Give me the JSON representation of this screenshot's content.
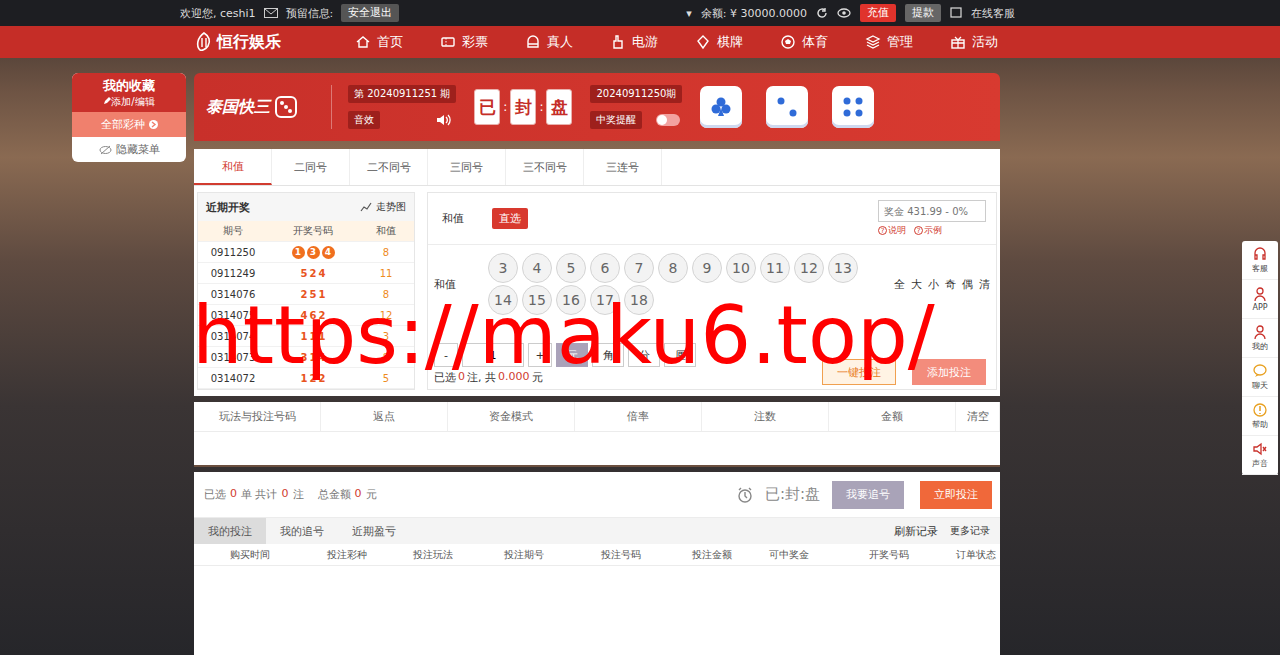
{
  "topbar": {
    "welcome": "欢迎您, ceshi1",
    "reserved": "预留信息:",
    "logout": "安全退出",
    "caret": "▾",
    "balance": "余额: ¥ 30000.0000",
    "recharge": "充值",
    "withdraw": "提款",
    "service": "在线客服"
  },
  "nav": {
    "logo": "恒行娱乐",
    "items": [
      {
        "label": "首页"
      },
      {
        "label": "彩票"
      },
      {
        "label": "真人"
      },
      {
        "label": "电游"
      },
      {
        "label": "棋牌"
      },
      {
        "label": "体育"
      },
      {
        "label": "管理"
      },
      {
        "label": "活动"
      }
    ]
  },
  "sidebar": {
    "title": "我的收藏",
    "edit": "添加/编辑",
    "items": [
      {
        "label": "全部彩种",
        "selected": true
      },
      {
        "label": "隐藏菜单",
        "selected": false
      }
    ]
  },
  "game": {
    "name": "泰国快三",
    "current_issue": "第 20240911251 期",
    "sound": "音效",
    "countdown": [
      "已",
      "封",
      "盘"
    ],
    "separator": ":",
    "last_issue": "20240911250期",
    "notify": "中奖提醒",
    "notify_on": false,
    "dice": [
      {
        "kind": "club"
      },
      {
        "kind": "two"
      },
      {
        "kind": "four"
      }
    ]
  },
  "play_tabs": [
    {
      "label": "和值",
      "selected": true
    },
    {
      "label": "二同号",
      "selected": false
    },
    {
      "label": "二不同号",
      "selected": false
    },
    {
      "label": "三同号",
      "selected": false
    },
    {
      "label": "三不同号",
      "selected": false
    },
    {
      "label": "三连号",
      "selected": false
    }
  ],
  "recent": {
    "title": "近期开奖",
    "trend": "走势图",
    "columns": [
      "期号",
      "开奖号码",
      "和值"
    ],
    "rows": [
      {
        "issue": "0911250",
        "numbers": [
          "1",
          "3",
          "4"
        ],
        "sum": "8",
        "latest": true
      },
      {
        "issue": "0911249",
        "numbers": [
          "5",
          "2",
          "4"
        ],
        "sum": "11",
        "latest": false
      },
      {
        "issue": "0314076",
        "numbers": [
          "2",
          "5",
          "1"
        ],
        "sum": "8",
        "latest": false
      },
      {
        "issue": "0314075",
        "numbers": [
          "4",
          "6",
          "2"
        ],
        "sum": "12",
        "latest": false
      },
      {
        "issue": "0314074",
        "numbers": [
          "1",
          "1",
          "1"
        ],
        "sum": "3",
        "latest": false
      },
      {
        "issue": "0314073",
        "numbers": [
          "3",
          "1",
          "4"
        ],
        "sum": "8",
        "latest": false
      },
      {
        "issue": "0314072",
        "numbers": [
          "1",
          "2",
          "2"
        ],
        "sum": "5",
        "latest": false
      }
    ]
  },
  "bet": {
    "label": "和值",
    "mode": "直选",
    "prize_placeholder": "奖金 431.99 - 0%",
    "help": "说明",
    "example": "示例",
    "help_mark": "?",
    "row_label": "和值",
    "numbers": [
      {
        "label": "3",
        "selected": false
      },
      {
        "label": "4",
        "selected": false
      },
      {
        "label": "5",
        "selected": false
      },
      {
        "label": "6",
        "selected": false
      },
      {
        "label": "7",
        "selected": false
      },
      {
        "label": "8",
        "selected": false
      },
      {
        "label": "9",
        "selected": false
      },
      {
        "label": "10",
        "selected": false
      },
      {
        "label": "11",
        "selected": false
      },
      {
        "label": "12",
        "selected": false
      },
      {
        "label": "13",
        "selected": false
      },
      {
        "label": "14",
        "selected": false
      },
      {
        "label": "15",
        "selected": false
      },
      {
        "label": "16",
        "selected": false
      },
      {
        "label": "17",
        "selected": false
      },
      {
        "label": "18",
        "selected": false
      }
    ],
    "quick": [
      "全",
      "大",
      "小",
      "奇",
      "偶",
      "清"
    ],
    "minus": "-",
    "multiplier": "1",
    "plus": "+",
    "units": [
      {
        "label": "元",
        "selected": true
      },
      {
        "label": "角",
        "selected": false
      },
      {
        "label": "分",
        "selected": false
      },
      {
        "label": "厘",
        "selected": false
      }
    ],
    "selection": {
      "prefix": "已选",
      "count": "0",
      "middle": "注, 共",
      "amount": "0.000",
      "suffix": "元"
    },
    "quick_bet": "一键投注",
    "add_bet": "添加投注"
  },
  "order": {
    "columns": [
      "玩法与投注号码",
      "返点",
      "资金模式",
      "倍率",
      "注数",
      "金额",
      "清空"
    ]
  },
  "summary": {
    "selected": "已选",
    "orders": "0",
    "orders_unit": "单 共计",
    "bets": "0",
    "bets_unit": "注",
    "total": "总金额",
    "amount": "0",
    "amount_unit": "元",
    "countdown": "已:封:盘",
    "chase": "我要追号",
    "submit": "立即投注"
  },
  "records": {
    "tabs": [
      {
        "label": "我的投注",
        "selected": true
      },
      {
        "label": "我的追号",
        "selected": false
      },
      {
        "label": "近期盈亏",
        "selected": false
      }
    ],
    "refresh": "刷新记录",
    "more": "更多记录",
    "columns": [
      "购买时间",
      "投注彩种",
      "投注玩法",
      "投注期号",
      "投注号码",
      "投注金额",
      "可中奖金",
      "开奖号码",
      "订单状态"
    ]
  },
  "side_tools": [
    {
      "label": "客服"
    },
    {
      "label": "APP"
    },
    {
      "label": "我的"
    },
    {
      "label": "聊天"
    },
    {
      "label": "帮助"
    },
    {
      "label": "声音"
    }
  ],
  "watermark": "https://maku6.top/"
}
